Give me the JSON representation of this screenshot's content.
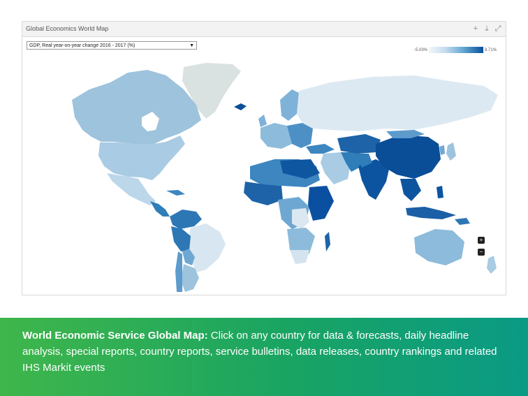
{
  "panel": {
    "title": "Global Economics World Map",
    "icons": [
      "plus-icon",
      "download-icon",
      "expand-icon"
    ]
  },
  "selector": {
    "value": "GDP, Real year-on-year change 2016 - 2017 (%)"
  },
  "legend": {
    "min": "-5.03%",
    "max": "8.71%",
    "colors": [
      "#f2f7fb",
      "#c6dbef",
      "#6baed6",
      "#08519c"
    ]
  },
  "zoom": {
    "in": "+",
    "out": "−"
  },
  "banner": {
    "headline": "World Economic Service Global Map:",
    "body": "Click on any country for data & forecasts, daily headline analysis, special reports, country reports, service bulletins, data releases, country rankings and related IHS Markit events"
  }
}
